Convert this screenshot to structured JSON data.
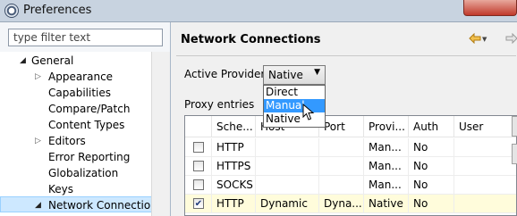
{
  "window": {
    "title": "Preferences"
  },
  "filter": {
    "placeholder": "type filter text"
  },
  "tree": {
    "items": [
      {
        "label": "General",
        "expander": "open"
      },
      {
        "label": "Appearance",
        "expander": "closed"
      },
      {
        "label": "Capabilities",
        "expander": ""
      },
      {
        "label": "Compare/Patch",
        "expander": ""
      },
      {
        "label": "Content Types",
        "expander": ""
      },
      {
        "label": "Editors",
        "expander": "closed"
      },
      {
        "label": "Error Reporting",
        "expander": ""
      },
      {
        "label": "Globalization",
        "expander": ""
      },
      {
        "label": "Keys",
        "expander": ""
      },
      {
        "label": "Network Connection",
        "expander": "open",
        "selected": true
      }
    ]
  },
  "page": {
    "title": "Network Connections",
    "provider_label": "Active Provider:",
    "provider_value": "Native",
    "provider_options": [
      "Direct",
      "Manual",
      "Native"
    ],
    "highlighted_option": "Manual",
    "proxy_entries_label": "Proxy entries"
  },
  "table": {
    "headers": [
      "",
      "Sche...",
      "Host",
      "Port",
      "Provi...",
      "Auth",
      "User"
    ],
    "rows": [
      {
        "checked": false,
        "scheme": "HTTP",
        "host": "",
        "port": "",
        "provider": "Man...",
        "auth": "No",
        "user": ""
      },
      {
        "checked": false,
        "scheme": "HTTPS",
        "host": "",
        "port": "",
        "provider": "Man...",
        "auth": "No",
        "user": ""
      },
      {
        "checked": false,
        "scheme": "SOCKS",
        "host": "",
        "port": "",
        "provider": "Man...",
        "auth": "No",
        "user": ""
      },
      {
        "checked": true,
        "scheme": "HTTP",
        "host": "Dynamic",
        "port": "Dyna...",
        "provider": "Native",
        "auth": "No",
        "user": ""
      }
    ]
  },
  "colors": {
    "selection": "#3399ff",
    "row_highlight": "#fffcdb",
    "nav_arrow": "#e8a317"
  }
}
